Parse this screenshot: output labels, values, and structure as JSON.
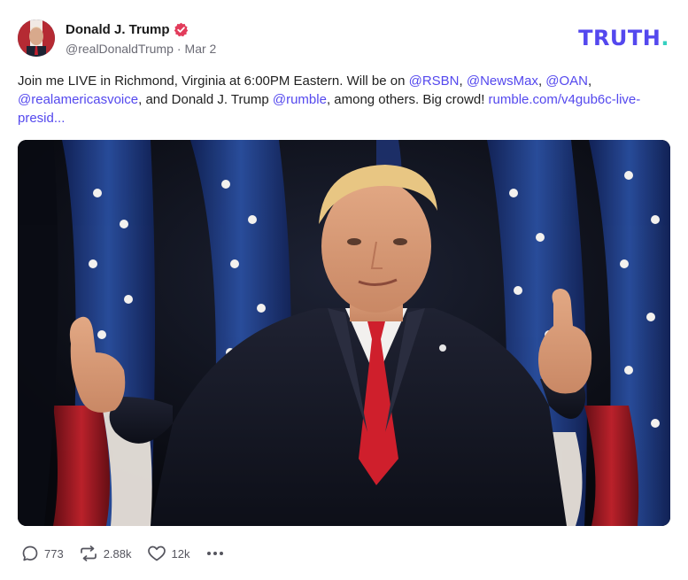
{
  "post": {
    "author_name": "Donald J. Trump",
    "handle": "@realDonaldTrump",
    "separator": "·",
    "date": "Mar 2",
    "text_intro": "Join me LIVE in Richmond, Virginia at 6:00PM Eastern. Will be on ",
    "mention_rsbn": "@RSBN",
    "comma1": ", ",
    "mention_newsmax": "@NewsMax",
    "comma2": ", ",
    "mention_oan": "@OAN",
    "comma3": ", ",
    "mention_rav": "@realamericasvoice",
    "text_mid": ", and Donald J. Trump ",
    "mention_rumble": "@rumble",
    "text_end": ", among others. Big crowd! ",
    "link_text": "rumble.com/v4gub6c-live-presid...",
    "image_alt": "Man in dark suit and red tie giving two thumbs up in front of American flags"
  },
  "brand": {
    "logo_main": "TRUTH",
    "logo_dot": ".",
    "logo_color": "#5448ee",
    "logo_dot_color": "#36d0c0",
    "verified_color": "#e23c5b"
  },
  "actions": {
    "reply_count": "773",
    "retruth_count": "2.88k",
    "like_count": "12k",
    "reply_icon": "reply-icon",
    "retruth_icon": "retruth-icon",
    "like_icon": "heart-icon",
    "more_icon": "more-icon"
  }
}
